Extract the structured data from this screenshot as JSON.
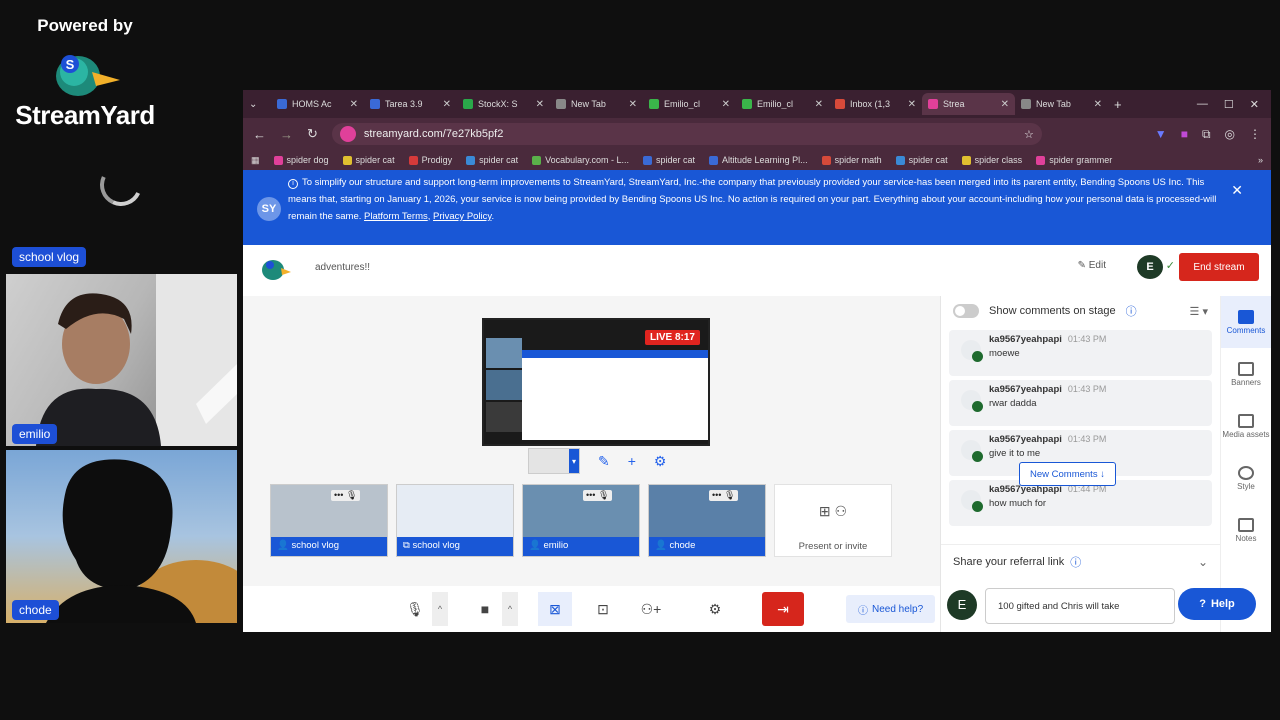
{
  "branding": {
    "powered": "Powered by",
    "name": "StreamYard"
  },
  "cameras": [
    {
      "label": "school vlog"
    },
    {
      "label": "emilio"
    },
    {
      "label": "chode"
    }
  ],
  "browser": {
    "tabs": [
      {
        "title": "HOMS Ac",
        "color": "#3a6ad6"
      },
      {
        "title": "Tarea 3.9",
        "color": "#3a6ad6"
      },
      {
        "title": "StockX: S",
        "color": "#2aa84a"
      },
      {
        "title": "New Tab",
        "color": "#888888"
      },
      {
        "title": "Emilio_cl",
        "color": "#3ab54a"
      },
      {
        "title": "Emilio_cl",
        "color": "#3ab54a"
      },
      {
        "title": "Inbox (1,3",
        "color": "#d64a3a"
      },
      {
        "title": "Strea",
        "color": "#e0409a"
      },
      {
        "title": "New Tab",
        "color": "#888888"
      }
    ],
    "url": "streamyard.com/7e27kb5pf2",
    "bookmarks": [
      {
        "label": "spider dog",
        "color": "#e0409a"
      },
      {
        "label": "spider cat",
        "color": "#e0c030"
      },
      {
        "label": "Prodigy",
        "color": "#d63a3a"
      },
      {
        "label": "spider cat",
        "color": "#3a8ad6"
      },
      {
        "label": "Vocabulary.com - L...",
        "color": "#5ab04a"
      },
      {
        "label": "spider cat",
        "color": "#3a6ad6"
      },
      {
        "label": "Altitude Learning Pl...",
        "color": "#3a6ad6"
      },
      {
        "label": "spider math",
        "color": "#d64a3a"
      },
      {
        "label": "spider cat",
        "color": "#3a8ad6"
      },
      {
        "label": "spider class",
        "color": "#e0c030"
      },
      {
        "label": "spider grammer",
        "color": "#e0409a"
      }
    ]
  },
  "banner": {
    "text": "To simplify our structure and support long-term improvements to StreamYard, StreamYard, Inc.-the company that previously provided your service-has been merged into its parent entity, Bending Spoons US Inc. This means that, starting on January 1, 2026, your service is now being provided by Bending Spoons US Inc. No action is required on your part. Everything about your account-including how your personal data is processed-will remain the same.",
    "link1": "Platform Terms",
    "sep": ", ",
    "link2": "Privacy Policy",
    "end": "."
  },
  "header": {
    "show_title": "adventures!!",
    "edit": "Edit",
    "end_stream": "End stream"
  },
  "stage": {
    "live_badge": "LIVE 8:17",
    "thumbs": [
      {
        "label": "school vlog"
      },
      {
        "label": "school vlog"
      },
      {
        "label": "emilio"
      },
      {
        "label": "chode"
      }
    ],
    "present_label": "Present or invite",
    "need_help": "Need help?"
  },
  "comments_panel": {
    "show_comments": "Show comments on stage",
    "comments": [
      {
        "user": "ka9567yeahpapi",
        "time": "01:43 PM",
        "text": "moewe"
      },
      {
        "user": "ka9567yeahpapi",
        "time": "01:43 PM",
        "text": "rwar dadda"
      },
      {
        "user": "ka9567yeahpapi",
        "time": "01:43 PM",
        "text": "give it to me"
      },
      {
        "user": "ka9567yeahpapi",
        "time": "01:44 PM",
        "text": "how much for"
      }
    ],
    "new_comments": "New Comments ↓",
    "referral": "Share your referral link",
    "chat_value": "100 gifted and Chris will take",
    "avatar_initial": "E"
  },
  "side_nav": [
    {
      "label": "Comments",
      "active": true
    },
    {
      "label": "Banners",
      "active": false
    },
    {
      "label": "Media assets",
      "active": false
    },
    {
      "label": "Style",
      "active": false
    },
    {
      "label": "Notes",
      "active": false
    }
  ],
  "help": "Help"
}
